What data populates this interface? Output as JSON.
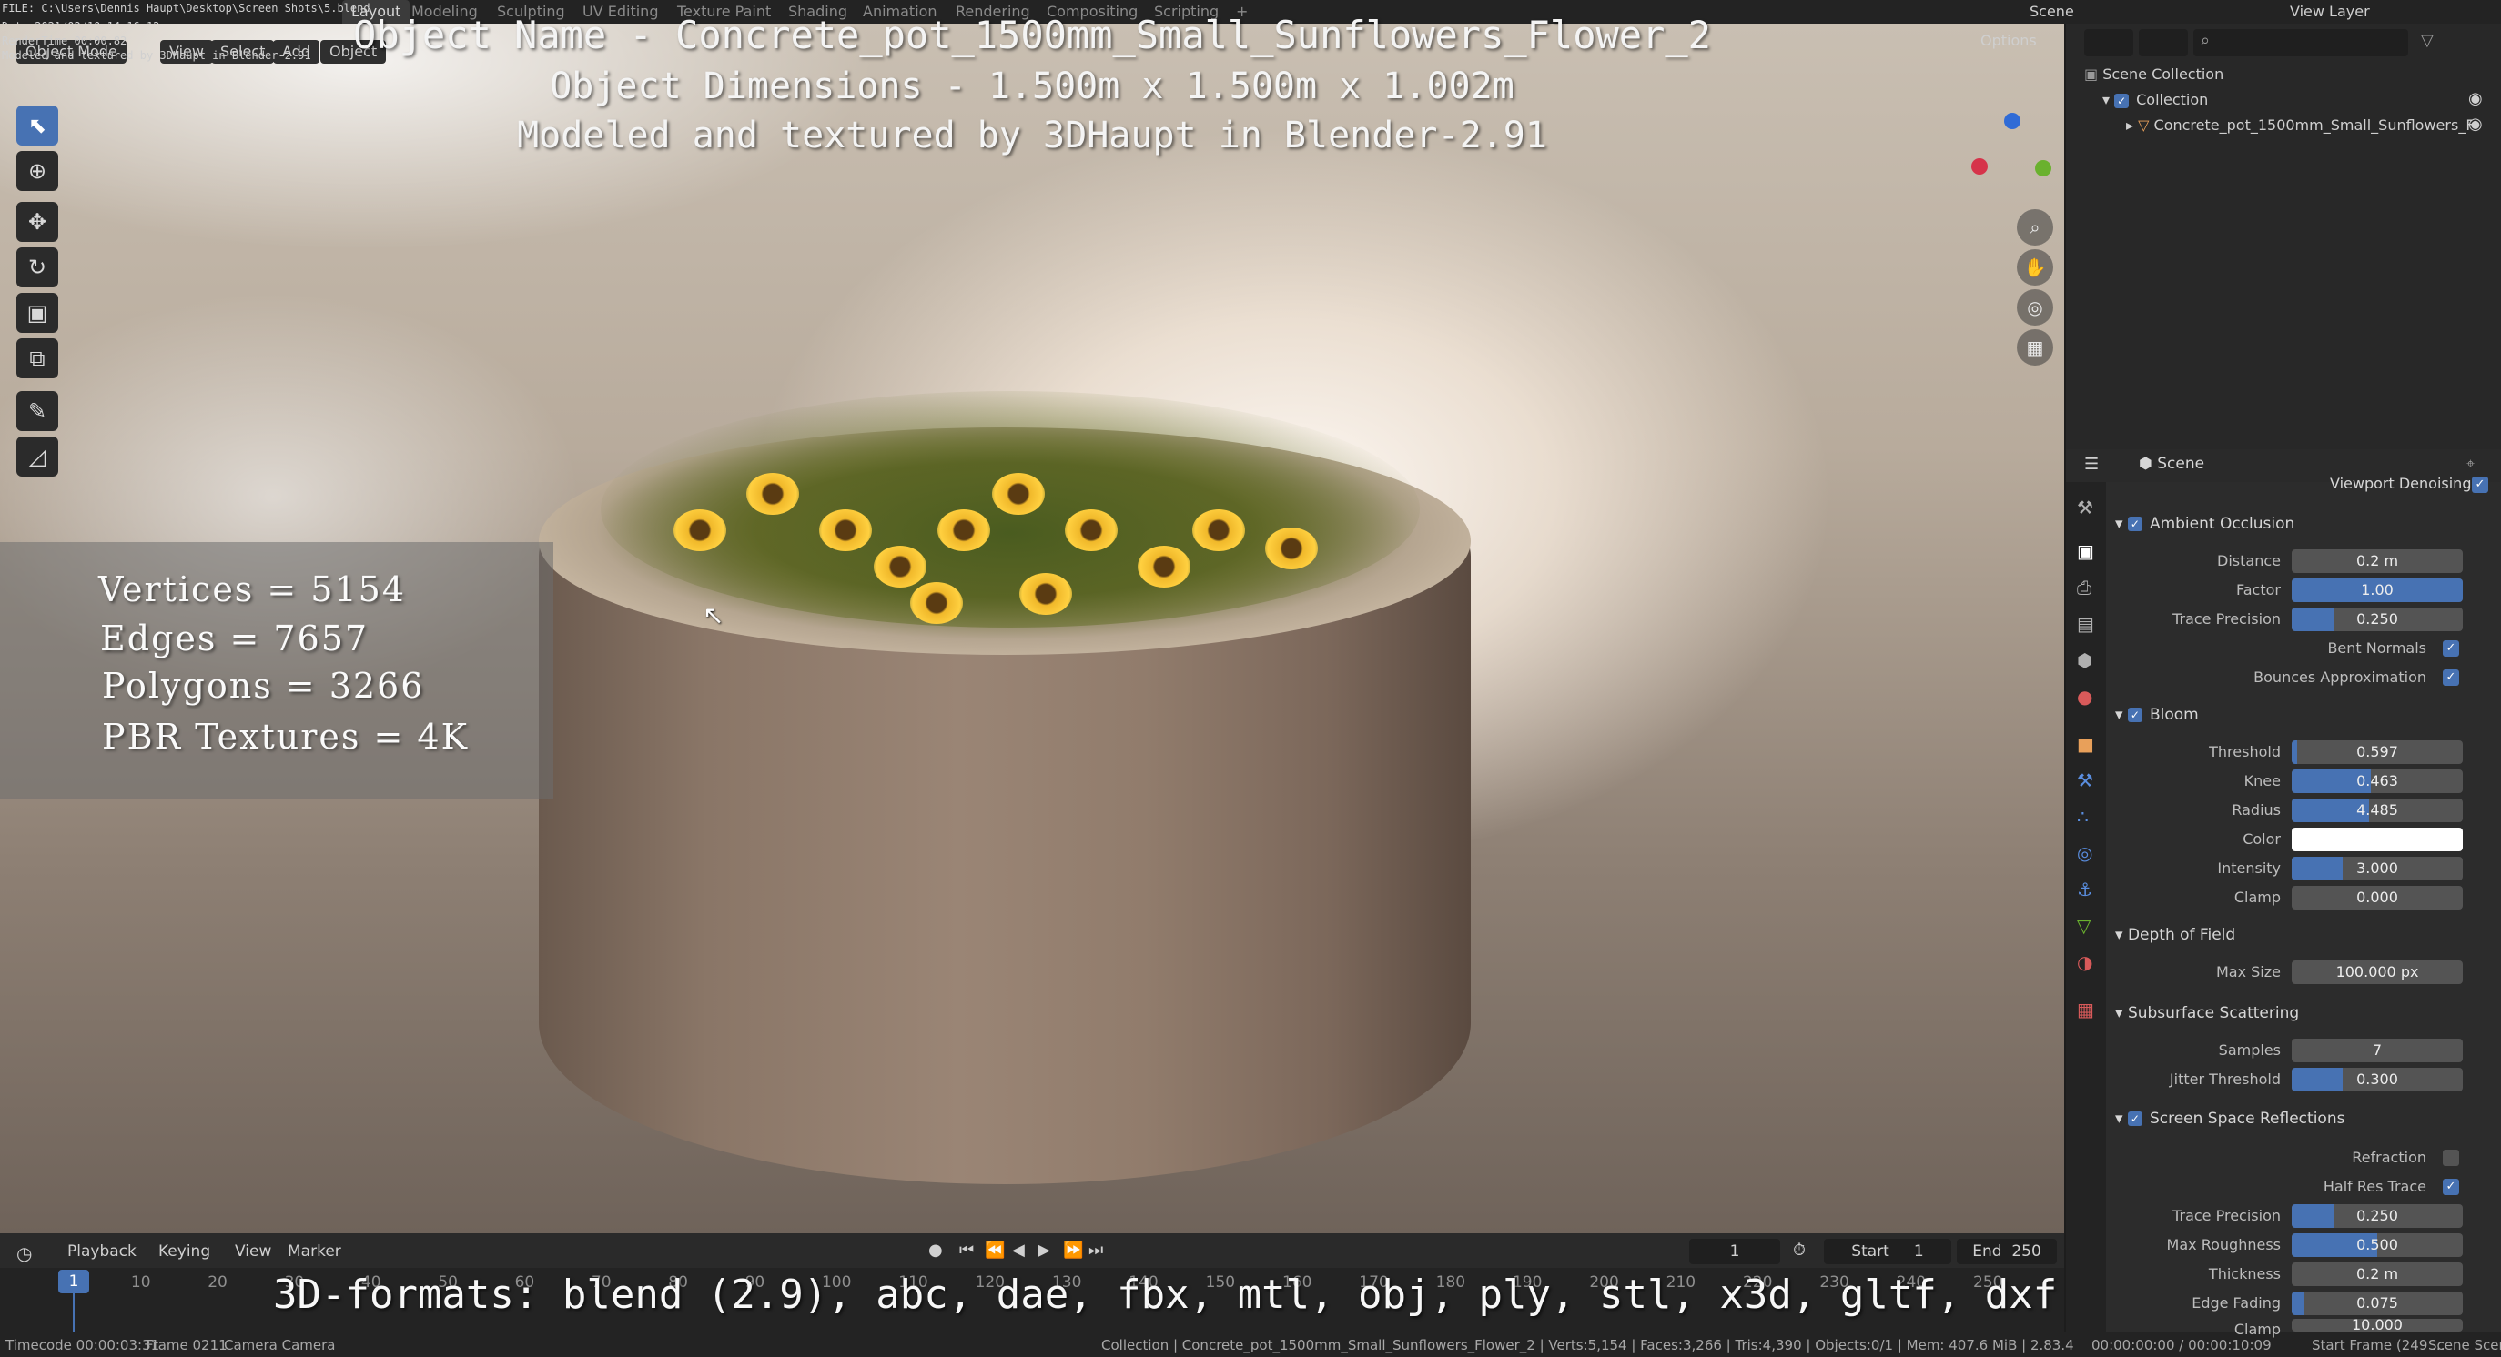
{
  "top_bar": {
    "workspace_tabs": [
      "Layout",
      "Modeling",
      "Sculpting",
      "UV Editing",
      "Texture Paint",
      "Shading",
      "Animation",
      "Rendering",
      "Compositing",
      "Scripting"
    ],
    "add_tab": "+",
    "scene_label": "Scene",
    "view_layer_label": "View Layer"
  },
  "overlay_info": {
    "file": "FILE: C:\\Users\\Dennis Haupt\\Desktop\\Screen Shots\\5.blend",
    "date": "Date 2021/02/10 14:16:12",
    "render_time": "RenderTime 00:00.82",
    "modeled": "Modeled and textured by 3DHaupt in Blender-2.91"
  },
  "viewport": {
    "mode_label": "Object Mode",
    "menus": [
      "View",
      "Select",
      "Add",
      "Object"
    ],
    "options_label": "Options",
    "title": "Object Name - Concrete_pot_1500mm_Small_Sunflowers_Flower_2",
    "dimensions": "Object Dimensions - 1.500m x 1.500m x 1.002m",
    "credit": "Modeled and textured by 3DHaupt in Blender-2.91"
  },
  "stats": {
    "vertices": "Vertices = 5154",
    "edges": "Edges = 7657",
    "polygons": "Polygons = 3266",
    "textures": "PBR Textures = 4K"
  },
  "timeline": {
    "menus": [
      "Playback",
      "Keying",
      "View",
      "Marker"
    ],
    "current_frame": "1",
    "start_label": "Start",
    "start_value": "1",
    "end_label": "End",
    "end_value": "250",
    "ticks": [
      "1",
      "10",
      "20",
      "30",
      "40",
      "50",
      "60",
      "70",
      "80",
      "90",
      "100",
      "110",
      "120",
      "130",
      "140",
      "150",
      "160",
      "170",
      "180",
      "190",
      "200",
      "210",
      "220",
      "230",
      "240",
      "250"
    ],
    "formats_overlay": "3D-formats: blend (2.9), abc, dae, fbx, mtl, obj, ply, stl, x3d, gltf, dxf"
  },
  "status_bar": {
    "timecode": "Timecode 00:00:03:31",
    "frame": "Frame 0211",
    "camera": "Camera Camera",
    "info": "Collection | Concrete_pot_1500mm_Small_Sunflowers_Flower_2 | Verts:5,154 | Faces:3,266 | Tris:4,390 | Objects:0/1 | Mem: 407.6 MiB | 2.83.4",
    "time": "00:00:00:00 / 00:00:10:09",
    "start_frame": "Start Frame (249 ...",
    "scene": "Scene Scene"
  },
  "outliner": {
    "scene_collection": "Scene Collection",
    "collection": "Collection",
    "object": "Concrete_pot_1500mm_Small_Sunflowers_F"
  },
  "properties": {
    "context": "Scene",
    "viewport_denoising": "Viewport Denoising",
    "ambient_occlusion": {
      "header": "Ambient Occlusion",
      "distance_label": "Distance",
      "distance": "0.2 m",
      "factor_label": "Factor",
      "factor": "1.00",
      "factor_fill": 1.0,
      "trace_precision_label": "Trace Precision",
      "trace_precision": "0.250",
      "trace_precision_fill": 0.25,
      "bent_normals": "Bent Normals",
      "bounces_approximation": "Bounces Approximation"
    },
    "bloom": {
      "header": "Bloom",
      "threshold_label": "Threshold",
      "threshold": "0.597",
      "threshold_fill": 0.03,
      "knee_label": "Knee",
      "knee": "0.463",
      "knee_fill": 0.463,
      "radius_label": "Radius",
      "radius": "4.485",
      "radius_fill": 0.45,
      "color_label": "Color",
      "intensity_label": "Intensity",
      "intensity": "3.000",
      "intensity_fill": 0.3,
      "clamp_label": "Clamp",
      "clamp": "0.000"
    },
    "dof": {
      "header": "Depth of Field",
      "max_size_label": "Max Size",
      "max_size": "100.000 px"
    },
    "sss": {
      "header": "Subsurface Scattering",
      "samples_label": "Samples",
      "samples": "7",
      "jitter_label": "Jitter Threshold",
      "jitter": "0.300",
      "jitter_fill": 0.3
    },
    "ssr": {
      "header": "Screen Space Reflections",
      "refraction": "Refraction",
      "half_res": "Half Res Trace",
      "trace_precision_label": "Trace Precision",
      "trace_precision": "0.250",
      "trace_precision_fill": 0.25,
      "max_roughness_label": "Max Roughness",
      "max_roughness": "0.500",
      "max_roughness_fill": 0.5,
      "thickness_label": "Thickness",
      "thickness": "0.2 m",
      "edge_fading_label": "Edge Fading",
      "edge_fading": "0.075",
      "edge_fading_fill": 0.075,
      "clamp_label": "Clamp",
      "clamp": "10.000"
    }
  }
}
